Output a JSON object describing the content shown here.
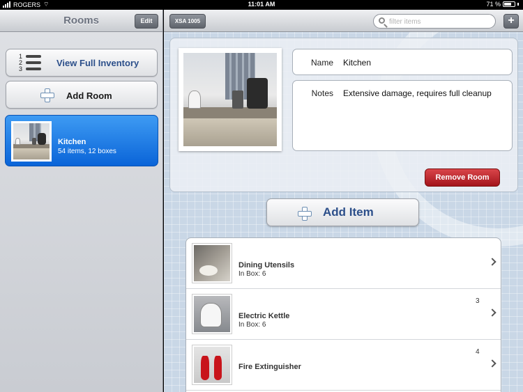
{
  "status_bar": {
    "carrier": "ROGERS",
    "time": "11:01 AM",
    "battery": "71 %",
    "battery_level": 0.71
  },
  "left": {
    "title": "Rooms",
    "edit_label": "Edit",
    "inventory": {
      "numbers": [
        "1",
        "2",
        "3"
      ],
      "label": "View Full Inventory"
    },
    "add_room_label": "Add Room",
    "rooms": [
      {
        "name": "Kitchen",
        "summary": "54 items, 12 boxes"
      }
    ]
  },
  "right": {
    "back_label": "XSA 1005",
    "search_placeholder": "filter items",
    "add_label": "+",
    "room": {
      "name_label": "Name",
      "name_value": "Kitchen",
      "notes_label": "Notes",
      "notes_value": "Extensive damage, requires full cleanup"
    },
    "remove_label": "Remove Room",
    "add_item_label": "Add Item",
    "items": [
      {
        "name": "Dining Utensils",
        "box": "In Box: 6",
        "num": ""
      },
      {
        "name": "Electric Kettle",
        "box": "In Box: 6",
        "num": "3"
      },
      {
        "name": "Fire Extinguisher",
        "box": "",
        "num": "4"
      }
    ]
  }
}
